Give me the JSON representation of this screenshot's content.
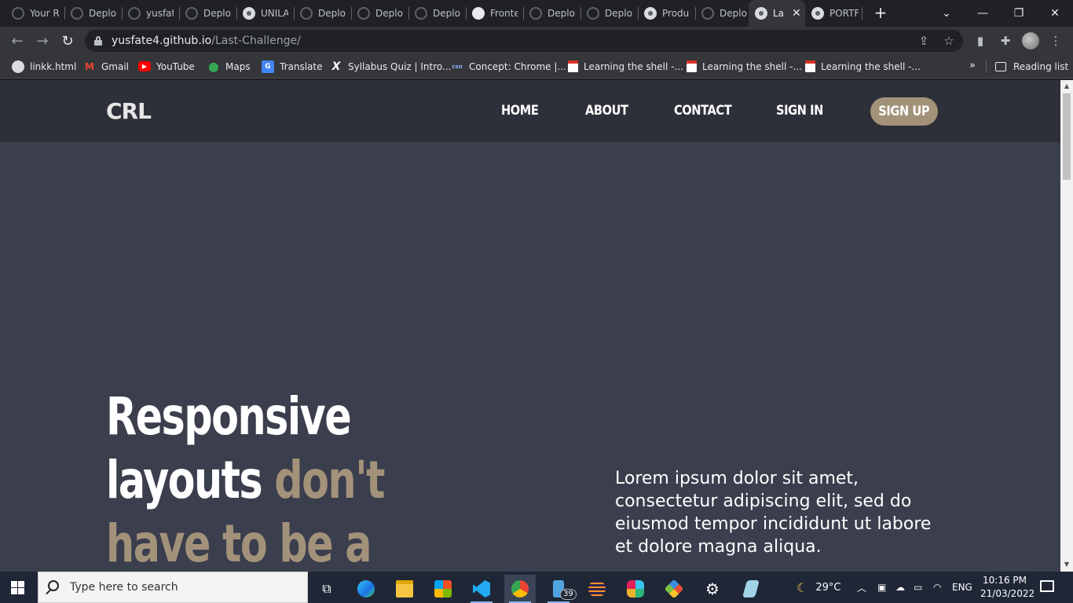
{
  "browser": {
    "tabs": [
      {
        "title": "Your R",
        "favicon": "github-icon"
      },
      {
        "title": "Deplo",
        "favicon": "github-icon"
      },
      {
        "title": "yusfat",
        "favicon": "github-icon"
      },
      {
        "title": "Deplo",
        "favicon": "github-icon"
      },
      {
        "title": "UNILA",
        "favicon": "globe-icon"
      },
      {
        "title": "Deplo",
        "favicon": "github-icon"
      },
      {
        "title": "Deplo",
        "favicon": "github-icon"
      },
      {
        "title": "Deplo",
        "favicon": "github-icon"
      },
      {
        "title": "Fronte",
        "favicon": "frontend-icon"
      },
      {
        "title": "Deplo",
        "favicon": "github-icon"
      },
      {
        "title": "Deplo",
        "favicon": "github-icon"
      },
      {
        "title": "Produ",
        "favicon": "globe-icon"
      },
      {
        "title": "Deplo",
        "favicon": "github-icon"
      },
      {
        "title": "La",
        "favicon": "globe-icon",
        "active": true
      },
      {
        "title": "PORTF",
        "favicon": "globe-icon"
      }
    ],
    "new_tab_label": "+",
    "address": {
      "host": "yusfate4.github.io",
      "path": "/Last-Challenge/"
    },
    "bookmarks": [
      {
        "label": "linkk.html",
        "icon": "globe-icon"
      },
      {
        "label": "Gmail",
        "icon": "gmail-icon"
      },
      {
        "label": "YouTube",
        "icon": "youtube-icon"
      },
      {
        "label": "Maps",
        "icon": "maps-icon"
      },
      {
        "label": "Translate",
        "icon": "translate-icon"
      },
      {
        "label": "Syllabus Quiz | Intro...",
        "icon": "x-icon"
      },
      {
        "label": "Concept: Chrome |...",
        "icon": "csn-icon"
      },
      {
        "label": "Learning the shell -...",
        "icon": "document-icon"
      },
      {
        "label": "Learning the shell -...",
        "icon": "document-icon"
      },
      {
        "label": "Learning the shell -...",
        "icon": "document-icon"
      }
    ],
    "bookmarks_overflow": "»",
    "reading_list": "Reading list"
  },
  "site": {
    "logo": "CRL",
    "nav": {
      "home": "HOME",
      "about": "ABOUT",
      "contact": "CONTACT",
      "signin": "SIGN IN",
      "signup": "SIGN UP"
    },
    "hero": {
      "line1": "Responsive",
      "line2_white": "layouts",
      "line2_accent": "don't",
      "line3_accent": "have to be a"
    },
    "lorem": "Lorem ipsum dolor sit amet, consectetur adipiscing elit, sed do eiusmod tempor incididunt ut labore et dolore magna aliqua.",
    "colors": {
      "header_bg": "#2e3039",
      "page_bg": "#3b3e4d",
      "accent": "#a3927a",
      "text": "#ffffff"
    }
  },
  "taskbar": {
    "search_placeholder": "Type here to search",
    "badge_count": "39",
    "weather": "29°C",
    "language": "ENG",
    "time": "10:16 PM",
    "date": "21/03/2022"
  }
}
